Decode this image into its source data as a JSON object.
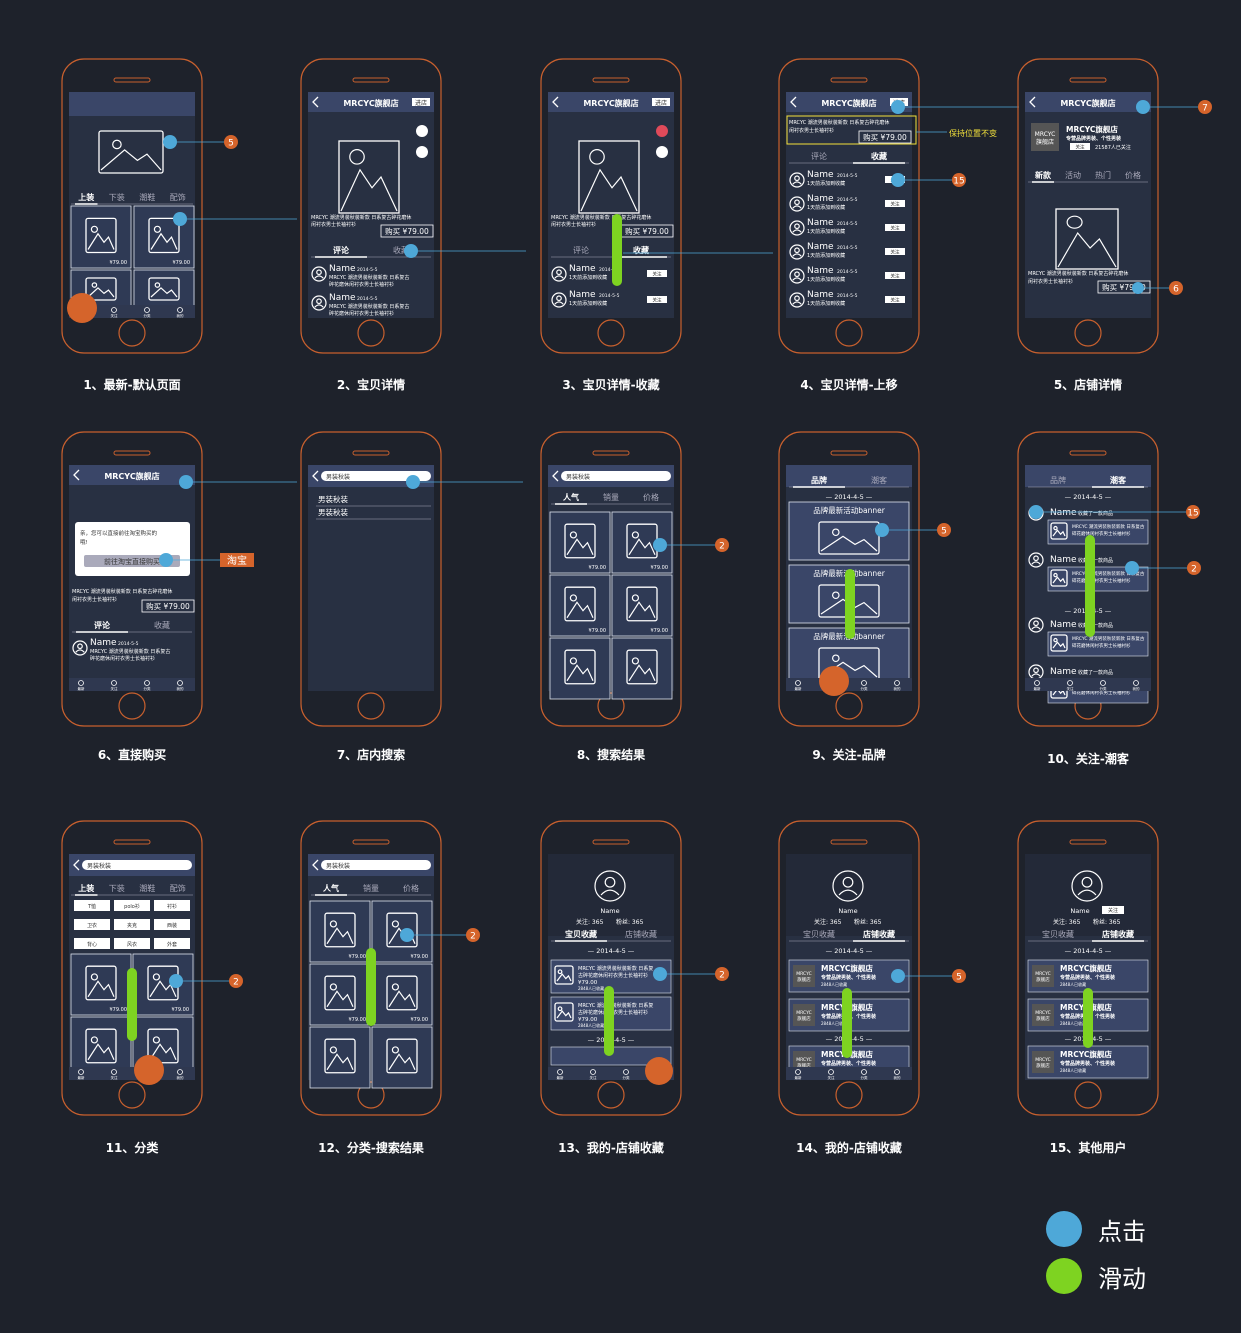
{
  "price_label": "购买 ¥79.00",
  "price_small": "¥79.00",
  "store_name": "MRCYC旗舰店",
  "store_short": "MRCYC\n旗舰店",
  "enter_store": "进店",
  "follow_label": "关注",
  "store_tagline": "专营品牌男装、个性男装",
  "store_followers": "21587人已关注",
  "store_followers_short": "2848人已收藏",
  "product_desc_1": "MRCYC 潮流男装秋装新款 日系复古碎花磨休",
  "product_desc_2": "闲衬衣男士长袖衬衫",
  "name_label": "Name",
  "comment_date": "2014-5-5",
  "comment_text_1": "MRCYC 潮流男装秋装新款 日系复古",
  "comment_text_2": "碎花磨休闲衬衣男士长袖衬衫",
  "added_text": "1天前添加到收藏",
  "collected_text": "收藏了一款商品",
  "search_query": "男装秋装",
  "suggestions": [
    "男装秋装",
    "男装秋装"
  ],
  "date_header": "2014-4-5",
  "banner_text": "品牌最新活动banner",
  "profile_follow": "关注: 365",
  "profile_fans": "粉丝: 365",
  "tabs_product": [
    "评论",
    "收藏"
  ],
  "tabs_cat": [
    "上装",
    "下装",
    "潮鞋",
    "配饰"
  ],
  "tabs_sort": [
    "人气",
    "销量",
    "价格"
  ],
  "tabs_store": [
    "新款",
    "活动",
    "热门",
    "价格"
  ],
  "tabs_follow": [
    "品牌",
    "潮客"
  ],
  "tabs_mine": [
    "宝贝收藏",
    "店铺收藏"
  ],
  "nav_labels": [
    "最新",
    "关注",
    "分类",
    "我的"
  ],
  "tag_chips": [
    "T恤",
    "polo衫",
    "衬衫",
    "卫衣",
    "夹克",
    "西装",
    "背心",
    "风衣",
    "外套"
  ],
  "dialog_text_1": "亲，您可以直接前往淘宝购买的",
  "dialog_text_2": "哦!",
  "dialog_button": "前往淘宝直接购买",
  "taobao_label": "淘宝",
  "keep_position_label": "保持位置不变",
  "annotation_numbers": {
    "n5": "5",
    "n6": "6",
    "n7": "7",
    "n15": "15",
    "n2": "2"
  },
  "captions": [
    "1、最新-默认页面",
    "2、宝贝详情",
    "3、宝贝详情-收藏",
    "4、宝贝详情-上移",
    "5、店铺详情",
    "6、直接购买",
    "7、店内搜索",
    "8、搜索结果",
    "9、关注-品牌",
    "10、关注-潮客",
    "11、分类",
    "12、分类-搜索结果",
    "13、我的-店铺收藏",
    "14、我的-店铺收藏",
    "15、其他用户"
  ],
  "legend": [
    {
      "label": "点击",
      "color": "#4ea8d8"
    },
    {
      "label": "滑动",
      "color": "#7ed321"
    }
  ],
  "colors": {
    "background": "#1e222b",
    "phone_outline": "#c8602e",
    "screen": "#283042",
    "header": "#3a4668",
    "tap": "#4ea8d8",
    "swipe": "#7ed321",
    "orange_marker": "#d5642b",
    "highlight": "#f3e13b"
  }
}
